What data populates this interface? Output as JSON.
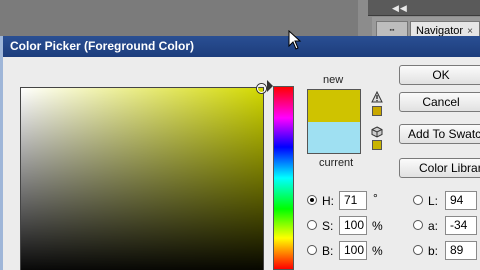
{
  "background": {
    "panel_collapse": "◀◀",
    "panel_grip": "▪▪",
    "navigator_tab": "Navigator",
    "navigator_close": "×"
  },
  "dialog": {
    "title": "Color Picker (Foreground Color)",
    "ok_label": "OK",
    "cancel_label": "Cancel",
    "add_swatch_label": "Add To Swatches",
    "libraries_label": "Color Libraries"
  },
  "swatches": {
    "new_label": "new",
    "current_label": "current",
    "new_color": "#cfc300",
    "current_color": "#9fe0f2",
    "gamut_color": "#c9a800",
    "web_color": "#c8b400"
  },
  "hsb": {
    "h_label": "H:",
    "h_value": "71",
    "h_unit": "°",
    "s_label": "S:",
    "s_value": "100",
    "s_unit": "%",
    "b_label": "B:",
    "b_value": "100",
    "b_unit": "%"
  },
  "lab": {
    "l_label": "L:",
    "l_value": "94",
    "a_label": "a:",
    "a_value": "-34",
    "b_label": "b:",
    "b_value": "89"
  },
  "icons": [
    "gamut-warning-icon",
    "web-cube-icon",
    "cursor-icon"
  ]
}
